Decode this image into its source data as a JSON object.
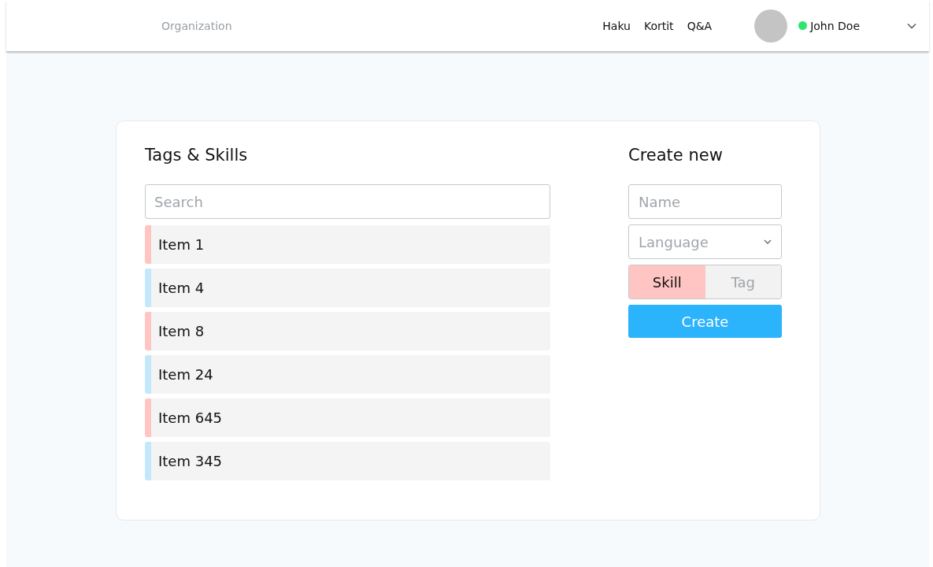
{
  "header": {
    "organization": "Organization",
    "nav": [
      "Haku",
      "Kortit",
      "Q&A"
    ],
    "user": {
      "name": "John Doe",
      "online": true
    }
  },
  "list": {
    "title": "Tags & Skills",
    "search": {
      "placeholder": "Search"
    },
    "items": [
      {
        "label": "Item 1",
        "color": "#ffc5c2"
      },
      {
        "label": "Item 4",
        "color": "#c2e8fa"
      },
      {
        "label": "Item 8",
        "color": "#ffc5c2"
      },
      {
        "label": "Item 24",
        "color": "#c2e8fa"
      },
      {
        "label": "Item 645",
        "color": "#ffc5c2"
      },
      {
        "label": "Item 345",
        "color": "#c2e8fa"
      }
    ]
  },
  "create": {
    "title": "Create new",
    "name": {
      "placeholder": "Name"
    },
    "language": {
      "placeholder": "Language"
    },
    "types": [
      {
        "label": "Skill",
        "selected": true
      },
      {
        "label": "Tag",
        "selected": false
      }
    ],
    "button": "Create"
  }
}
